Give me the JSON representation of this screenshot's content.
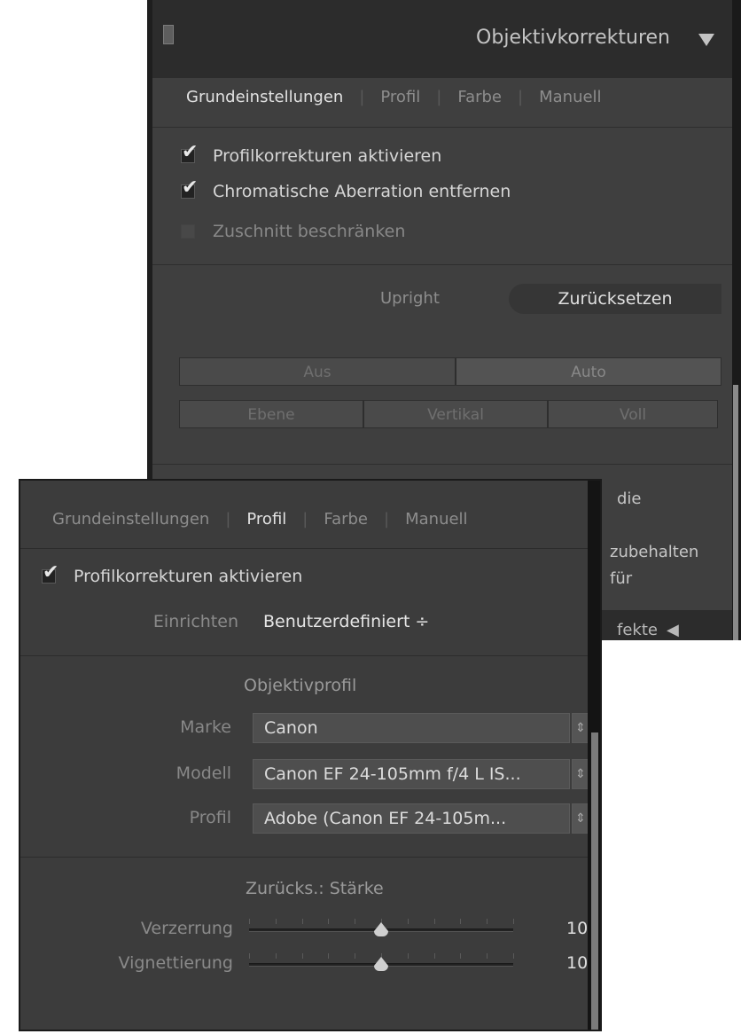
{
  "back_panel": {
    "title": "Objektivkorrekturen",
    "tabs": [
      {
        "label": "Grundeinstellungen",
        "active": true
      },
      {
        "label": "Profil",
        "active": false
      },
      {
        "label": "Farbe",
        "active": false
      },
      {
        "label": "Manuell",
        "active": false
      }
    ],
    "checkboxes": [
      {
        "label": "Profilkorrekturen aktivieren",
        "checked": true
      },
      {
        "label": "Chromatische Aberration entfernen",
        "checked": true
      },
      {
        "label": "Zuschnitt beschränken",
        "checked": false
      }
    ],
    "upright_label": "Upright",
    "reset_label": "Zurücksetzen",
    "mode_buttons": [
      "Aus",
      "Auto"
    ],
    "level_buttons": [
      "Ebene",
      "Vertikal",
      "Voll"
    ],
    "fragments": [
      "die",
      "zubehalten",
      "für",
      "fekte"
    ]
  },
  "front_panel": {
    "tabs": [
      {
        "label": "Grundeinstellungen",
        "active": false
      },
      {
        "label": "Profil",
        "active": true
      },
      {
        "label": "Farbe",
        "active": false
      },
      {
        "label": "Manuell",
        "active": false
      }
    ],
    "enable_checkbox": {
      "label": "Profilkorrekturen aktivieren",
      "checked": true
    },
    "setup": {
      "label": "Einrichten",
      "value": "Benutzerdefiniert ÷"
    },
    "lens_profile_title": "Objektivprofil",
    "fields": [
      {
        "label": "Marke",
        "value": "Canon"
      },
      {
        "label": "Modell",
        "value": "Canon EF 24-105mm f/4 L IS..."
      },
      {
        "label": "Profil",
        "value": "Adobe (Canon EF 24-105m..."
      }
    ],
    "amount_title": "Zurücks.: Stärke",
    "sliders": [
      {
        "label": "Verzerrung",
        "value": "10",
        "position": 0.5
      },
      {
        "label": "Vignettierung",
        "value": "10",
        "position": 0.5
      }
    ]
  }
}
